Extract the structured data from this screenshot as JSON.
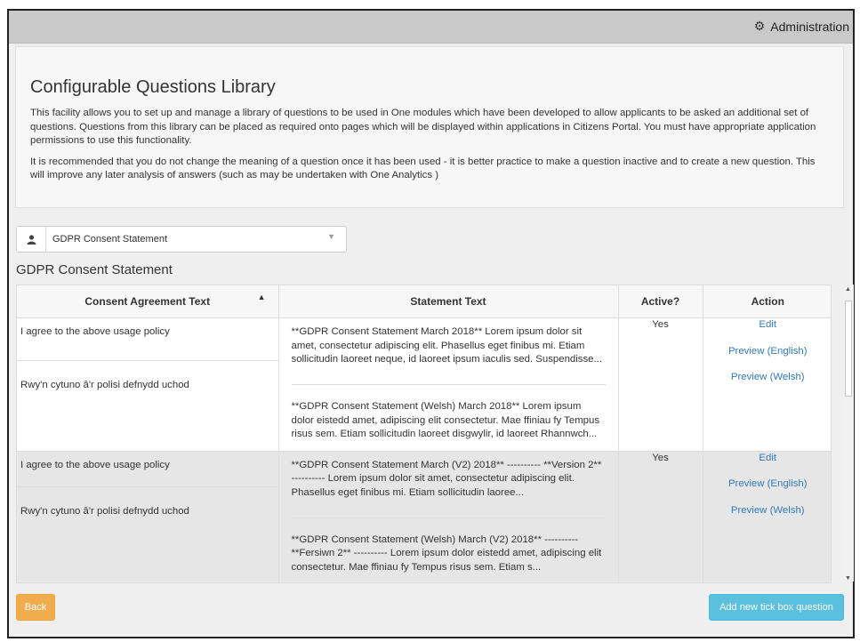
{
  "header": {
    "admin_label": "Administration",
    "admin_icon": "gear-icon"
  },
  "intro": {
    "title": "Configurable Questions Library",
    "para1": "This facility allows you to set up and manage a library of questions to be used in One modules which have been developed to allow applicants to be asked an additional set of questions. Questions from this library can be placed as required onto pages which will be displayed within applications in Citizens Portal. You must have appropriate application permissions to use this functionality.",
    "para2": "It is recommended that you do not change the meaning of a question once it has been used - it is better practice to make a question inactive and to create a new question. This will improve any later analysis of answers (such as may be undertaken with One Analytics )"
  },
  "selector": {
    "icon": "user-icon",
    "value": "GDPR Consent Statement"
  },
  "section": {
    "title": "GDPR Consent Statement"
  },
  "table": {
    "columns": [
      "Consent Agreement Text",
      "Statement Text",
      "Active?",
      "Action"
    ],
    "rows": [
      {
        "agreement_en": "I agree to the above usage policy",
        "agreement_cy": "Rwy'n cytuno â'r polisi defnydd uchod",
        "statement_en": "**GDPR Consent Statement March 2018** Lorem ipsum dolor sit amet, consectetur adipiscing elit. Phasellus eget finibus mi. Etiam sollicitudin laoreet neque, id laoreet ipsum iaculis sed. Suspendisse...",
        "statement_cy": "**GDPR Consent Statement (Welsh) March 2018** Lorem ipsum dolor eistedd amet, adipiscing elit consectetur. Mae ffiniau fy Tempus risus sem. Etiam sollicitudin laoreet disgwylir, id laoreet Rhannwch...",
        "active": "Yes",
        "action_edit": "Edit",
        "action_preview_en": "Preview (English)",
        "action_preview_cy": "Preview (Welsh)"
      },
      {
        "agreement_en": "I agree to the above usage policy",
        "agreement_cy": "Rwy'n cytuno â'r polisi defnydd uchod",
        "statement_en": "**GDPR Consent Statement March (V2) 2018** ---------- **Version 2** ---------- Lorem ipsum dolor sit amet, consectetur adipiscing elit. Phasellus eget finibus mi. Etiam sollicitudin laoree...",
        "statement_cy": "**GDPR Consent Statement (Welsh) March (V2) 2018** ---------- **Fersiwn 2** ---------- Lorem ipsum dolor eistedd amet, adipiscing elit consectetur. Mae ffiniau fy Tempus risus sem. Etiam s...",
        "active": "Yes",
        "action_edit": "Edit",
        "action_preview_en": "Preview (English)",
        "action_preview_cy": "Preview (Welsh)"
      }
    ]
  },
  "footer": {
    "back_label": "Back",
    "add_label": "Add new tick box question"
  }
}
